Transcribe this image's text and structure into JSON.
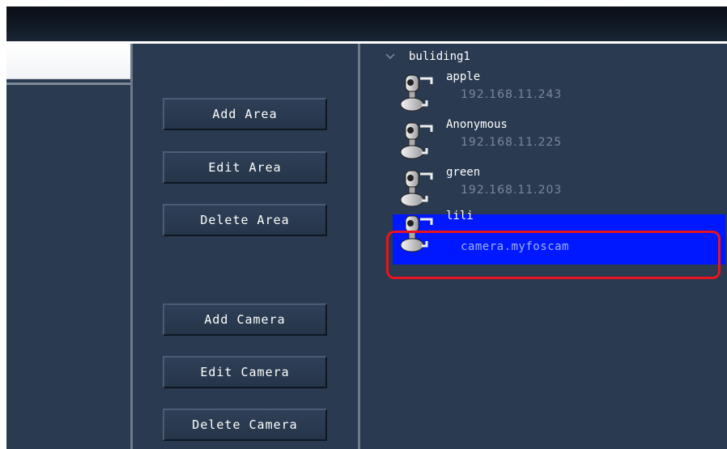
{
  "toolbar": {},
  "left": {},
  "buttons": {
    "add_area": "Add Area",
    "edit_area": "Edit Area",
    "delete_area": "Delete Area",
    "add_camera": "Add Camera",
    "edit_camera": "Edit Camera",
    "delete_camera": "Delete Camera"
  },
  "tree": {
    "area_name": "buliding1",
    "expand_icon": "chevron-down-icon",
    "cameras": [
      {
        "name": "apple",
        "ip": "192.168.11.243",
        "icon": "camera-icon"
      },
      {
        "name": "Anonymous",
        "ip": "192.168.11.225",
        "icon": "camera-icon"
      },
      {
        "name": "green",
        "ip": "192.168.11.203",
        "icon": "camera-icon"
      },
      {
        "name": "lili",
        "ip": "camera.myfoscam",
        "icon": "camera-icon",
        "selected": true
      }
    ]
  },
  "colors": {
    "panel_bg": "#2a3a51",
    "selection": "#0018ff",
    "annotation_box": "#e8141e"
  }
}
